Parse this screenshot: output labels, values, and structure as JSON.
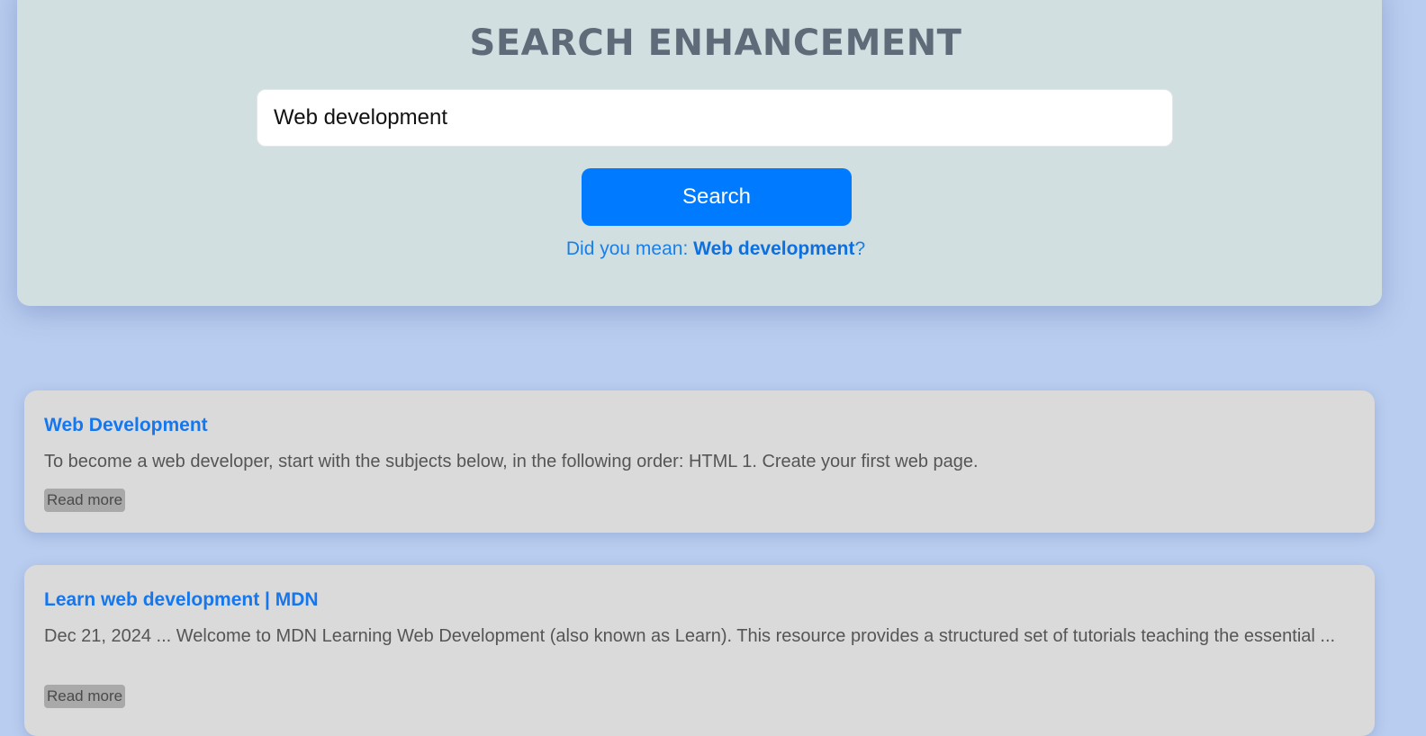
{
  "header": {
    "title": "SEARCH ENHANCEMENT"
  },
  "search": {
    "value": "Web development",
    "button_label": "Search"
  },
  "suggestion": {
    "prefix": "Did you mean: ",
    "term": "Web development",
    "suffix": "?"
  },
  "results": [
    {
      "title": "Web Development",
      "snippet": "To become a web developer, start with the subjects below, in the following order: HTML 1. Create your first web page.",
      "read_more": "Read more"
    },
    {
      "title": "Learn web development | MDN",
      "snippet": "Dec 21, 2024 ... Welcome to MDN Learning Web Development (also known as Learn). This resource provides a structured set of tutorials teaching the essential ...",
      "read_more": "Read more"
    }
  ],
  "colors": {
    "background": "#b9cdf0",
    "panel": "#d2dfe1",
    "accent": "#007bff",
    "card": "#dadada"
  }
}
